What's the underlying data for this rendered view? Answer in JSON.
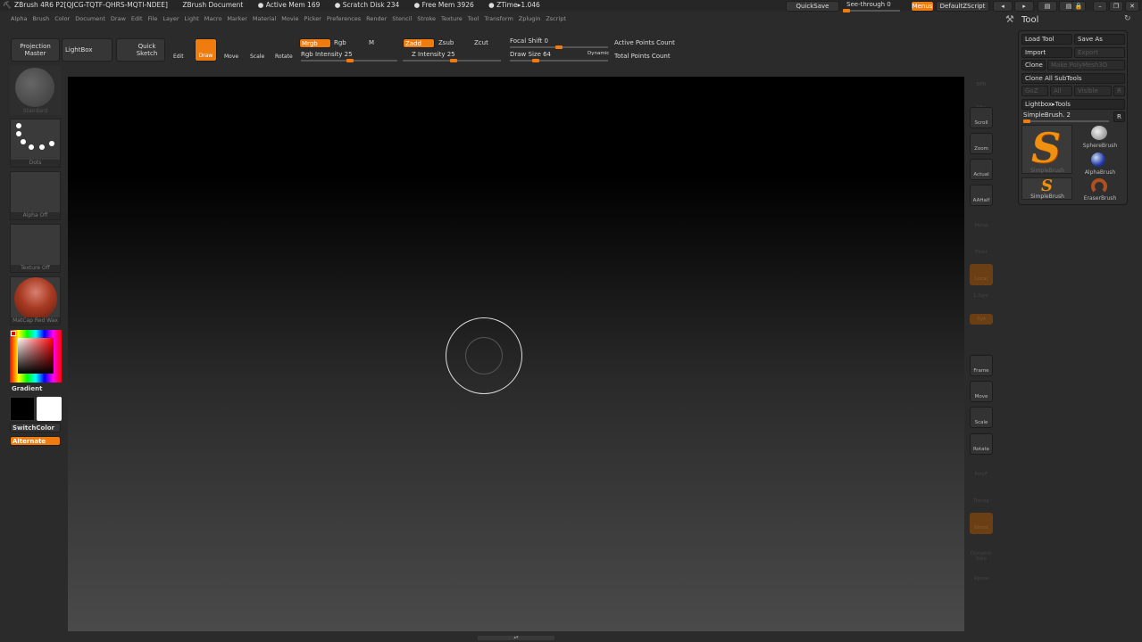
{
  "title_bar": {
    "app": "ZBrush 4R6 P2[QJCG-TQTF-QHRS-MQTI-NDEE]",
    "document": "ZBrush Document",
    "active_mem": "● Active Mem 169",
    "scratch_disk": "● Scratch Disk 234",
    "free_mem": "● Free Mem 3926",
    "ztime": "● ZTime▸1.046"
  },
  "menus": [
    "Alpha",
    "Brush",
    "Color",
    "Document",
    "Draw",
    "Edit",
    "File",
    "Layer",
    "Light",
    "Macro",
    "Marker",
    "Material",
    "Movie",
    "Picker",
    "Preferences",
    "Render",
    "Stencil",
    "Stroke",
    "Texture",
    "Tool",
    "Transform",
    "Zplugin",
    "Zscript"
  ],
  "top_right": {
    "quicksave": "QuickSave",
    "see_through": "See-through  0",
    "see_through_value": 0,
    "menus": "Menus",
    "default_zscript": "DefaultZScript"
  },
  "toolbar": {
    "projection_master": "Projection Master",
    "lightbox": "LightBox",
    "quick_sketch": "Quick Sketch",
    "edit": "Edit",
    "draw": "Draw",
    "move": "Move",
    "scale": "Scale",
    "rotate": "Rotate",
    "mrgb": "Mrgb",
    "rgb": "Rgb",
    "m": "M",
    "zadd": "Zadd",
    "zsub": "Zsub",
    "zcut": "Zcut",
    "rgb_intensity": "Rgb Intensity 25",
    "z_intensity": "Z Intensity 25",
    "focal_shift": "Focal Shift 0",
    "draw_size": "Draw Size 64",
    "dynamic": "Dynamic",
    "active_points": "Active Points Count",
    "total_points": "Total Points Count",
    "rgb_intensity_value": 25,
    "z_intensity_value": 25,
    "focal_shift_value": 0,
    "draw_size_value": 64
  },
  "left_shelf": {
    "brush": "Standard",
    "stroke": "Dots",
    "alpha": "Alpha Off",
    "texture": "Texture Off",
    "material": "MatCap Red Wax",
    "gradient": "Gradient",
    "switch_color": "SwitchColor",
    "alternate": "Alternate",
    "main_color": "#000000",
    "secondary_color": "#ffffff"
  },
  "right_shelf": [
    "BPR",
    "SPix",
    "Scroll",
    "Zoom",
    "Actual",
    "AAHalf",
    "Persp",
    "Floor",
    "Local",
    "L.Sym",
    "Xyz",
    "",
    "",
    "Frame",
    "Move",
    "Scale",
    "Rotate",
    "PolyF",
    "Transp",
    "Ghost",
    "Dynamic Solo",
    "Xpose"
  ],
  "tool_panel": {
    "title": "Tool",
    "load_tool": "Load Tool",
    "save_as": "Save As",
    "import": "Import",
    "export": "Export",
    "clone": "Clone",
    "make_polymesh": "Make PolyMesh3D",
    "clone_all": "Clone All SubTools",
    "goz": "GoZ",
    "all": "All",
    "visible": "Visible",
    "r": "R",
    "lightbox_tools": "Lightbox▸Tools",
    "current_tool": "SimpleBrush. 2",
    "r2": "R",
    "brushes": [
      "SimpleBrush",
      "SphereBrush",
      "AlphaBrush",
      "SimpleBrush",
      "EraserBrush"
    ]
  },
  "colors": {
    "accent": "#f07c10"
  }
}
